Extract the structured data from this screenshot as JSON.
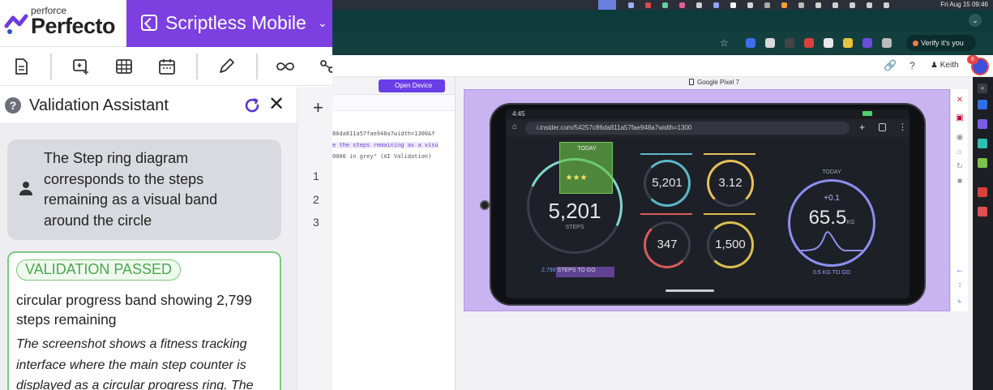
{
  "brand": {
    "small_label": "perforce",
    "name": "Perfecto"
  },
  "module": {
    "title": "Scriptless Mobile"
  },
  "toolbar": {
    "icons": [
      "document-icon",
      "add-screen-icon",
      "table-icon",
      "calendar-icon",
      "pencil-icon",
      "loop-icon",
      "share-icon"
    ]
  },
  "validation_assistant": {
    "help": "?",
    "title": "Validation Assistant",
    "user_message": "The Step ring diagram corresponds to the steps remaining as a visual band around the circle",
    "result_badge": "VALIDATION PASSED",
    "result_summary": "circular progress band showing 2,799 steps remaining",
    "result_detail": "The screenshot shows a fitness tracking interface where the main step counter is displayed as a circular progress ring. The"
  },
  "editor": {
    "add_label": "+",
    "line_numbers": [
      "1",
      "2",
      "3"
    ]
  },
  "os_bar": {
    "clock": "Fri Aug 15 09:46"
  },
  "browser": {
    "verify_label": "Verify it's you",
    "user_name": "Keith",
    "notification_count": "6"
  },
  "code_panel": {
    "open_device_label": "Open Device",
    "lines": [
      "86da811a57fae948a7width=1300&f",
      "e the steps remaining as a visu",
      "0000 in grey\" (AI Validation)"
    ]
  },
  "device": {
    "label": "Google Pixel 7",
    "status_time": "4:45",
    "url": "i.insider.com/54257c86da811a57fae948a7width=1300",
    "dashboard": {
      "steps_today_label": "TODAY",
      "main_steps_value": "5,201",
      "main_steps_caption": "STEPS",
      "steps_remaining_value": "2,799",
      "steps_remaining_label": "STEPS TO GO",
      "steps_small_value": "5,201",
      "distance_value": "3.12",
      "calories_value": "347",
      "floors_value": "1,500",
      "weight_today_label": "TODAY",
      "weight_delta": "+0.1",
      "weight_value": "65.5",
      "weight_unit": "KG",
      "weight_remaining": "0.5 KG TO GO",
      "rating_stars": "★★★"
    }
  },
  "colors": {
    "brand_purple": "#7c3fe0",
    "pass_green": "#4aa84f",
    "browser_teal": "#13403f",
    "stage_lavender": "#c9b3f0"
  }
}
